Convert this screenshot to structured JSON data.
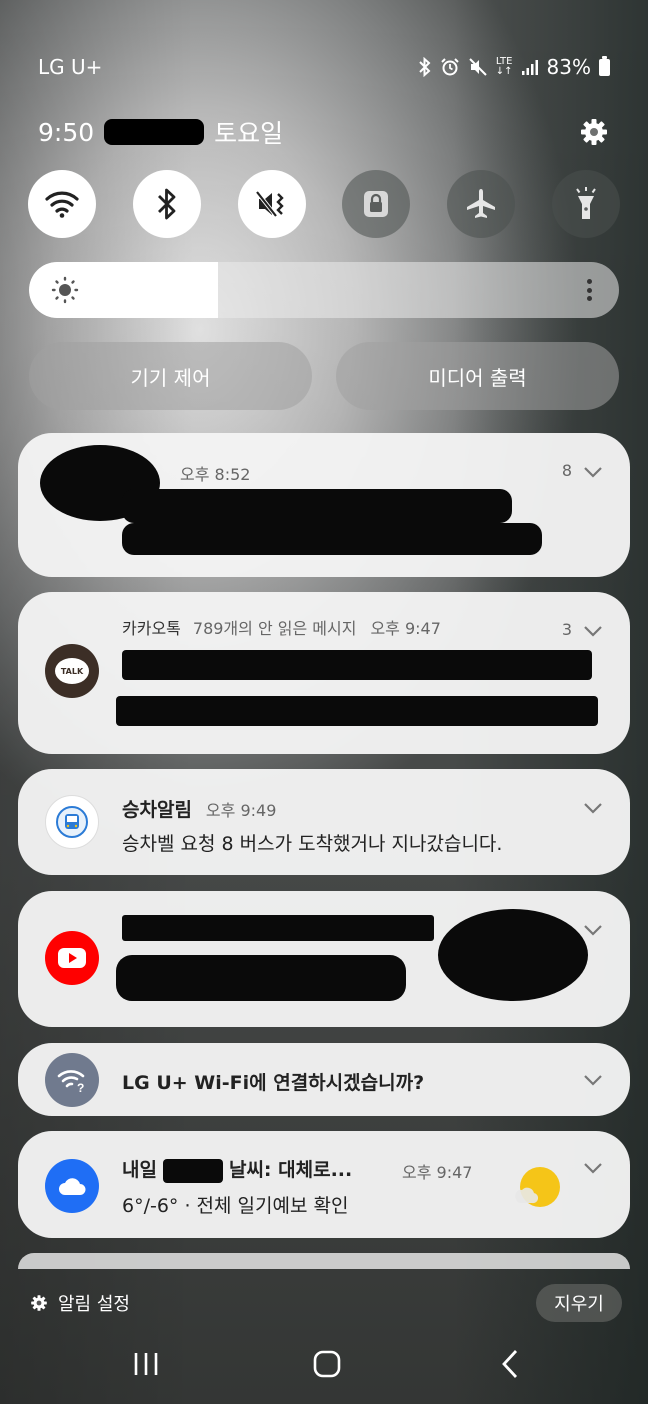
{
  "status_bar": {
    "carrier": "LG U+",
    "lte_label": "LTE",
    "battery": "83%"
  },
  "header": {
    "time": "9:50",
    "day": "토요일"
  },
  "quick_settings": [
    {
      "name": "wifi",
      "on": true
    },
    {
      "name": "bluetooth",
      "on": true
    },
    {
      "name": "sound-mute",
      "on": true
    },
    {
      "name": "screen-lock-rotation",
      "on": false
    },
    {
      "name": "airplane-mode",
      "on": false
    },
    {
      "name": "flashlight",
      "on": false
    }
  ],
  "brightness": {
    "level": 0.32
  },
  "panel_buttons": {
    "device_control": "기기 제어",
    "media_output": "미디어 출력"
  },
  "notifications": [
    {
      "app": "",
      "time": "오후 8:52",
      "count": "8"
    },
    {
      "app": "카카오톡",
      "subtitle": "789개의 안 읽은 메시지",
      "time": "오후 9:47",
      "count": "3",
      "icon_label": "TALK"
    },
    {
      "app": "승차알림",
      "time": "오후 9:49",
      "body": "승차벨 요청 8 버스가 도착했거나 지나갔습니다."
    },
    {
      "app": "YouTube"
    },
    {
      "title": "LG U+ Wi-Fi에 연결하시겠습니까?"
    },
    {
      "title_prefix": "내일",
      "title_suffix": "날씨: 대체로...",
      "time": "오후 9:47",
      "body": "6°/-6° · 전체 일기예보 확인"
    }
  ],
  "footer": {
    "settings_label": "알림 설정",
    "clear_label": "지우기"
  },
  "colors": {
    "youtube_red": "#ff0000",
    "weather_blue": "#1f6ef5",
    "kakao_brown": "#3c2e26",
    "sun_yellow": "#f5c518"
  }
}
